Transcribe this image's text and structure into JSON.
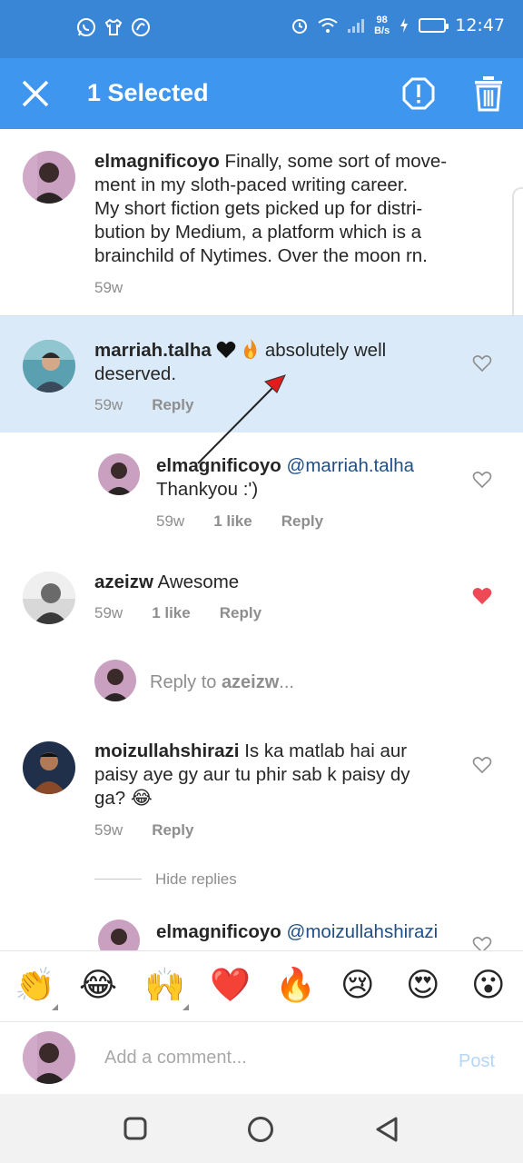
{
  "status_bar": {
    "time": "12:47",
    "speed_value": "98",
    "speed_unit": "B/s",
    "icons": [
      "whatsapp-icon",
      "shirt-icon",
      "app-icon",
      "alarm-icon",
      "wifi-icon",
      "signal-icon",
      "battery-charging-icon"
    ]
  },
  "action_bar": {
    "title": "1 Selected",
    "icons": [
      "close-icon",
      "report-icon",
      "delete-icon"
    ]
  },
  "comments": [
    {
      "username": "elmagnificoyo",
      "text_lines": [
        "Finally, some sort of move-",
        "ment in my sloth-paced writing career.",
        "My short fiction gets picked up for distri-",
        "bution by Medium, a platform which is a",
        "brainchild of Nytimes. Over the moon rn."
      ],
      "time": "59w"
    },
    {
      "username": "marriah.talha",
      "text_line1": "absolutely well",
      "text_line2": "deserved.",
      "time": "59w",
      "reply_label": "Reply",
      "selected": true
    },
    {
      "username": "elmagnificoyo",
      "mention": "@marriah.talha",
      "text": "Thankyou :')",
      "time": "59w",
      "likes": "1 like",
      "reply_label": "Reply"
    },
    {
      "username": "azeizw",
      "text": "Awesome",
      "time": "59w",
      "likes": "1 like",
      "reply_label": "Reply",
      "liked": true
    },
    {
      "reply_prompt": "Reply to ",
      "reply_target": "azeizw",
      "ellipsis": "..."
    },
    {
      "username": "moizullahshirazi",
      "text_line1": "Is ka matlab hai aur",
      "text_line2": "paisy aye gy aur tu phir sab k paisy dy",
      "text_line3": "ga? 😂",
      "time": "59w",
      "reply_label": "Reply",
      "hide_replies": "Hide replies"
    },
    {
      "username": "elmagnificoyo",
      "mention": "@moizullahshirazi"
    }
  ],
  "emoji_bar": [
    "👏",
    "😂",
    "🙌",
    "❤️",
    "🔥",
    "😢",
    "😍",
    "😮"
  ],
  "composer": {
    "placeholder": "Add a comment...",
    "post_label": "Post"
  },
  "colors": {
    "status_bar": "#3a86d6",
    "action_bar": "#3f96ef",
    "selected_row": "#dbeaf8",
    "liked_heart": "#ed4956",
    "mention": "#1f4f85",
    "post_disabled": "#b4d6f8"
  }
}
